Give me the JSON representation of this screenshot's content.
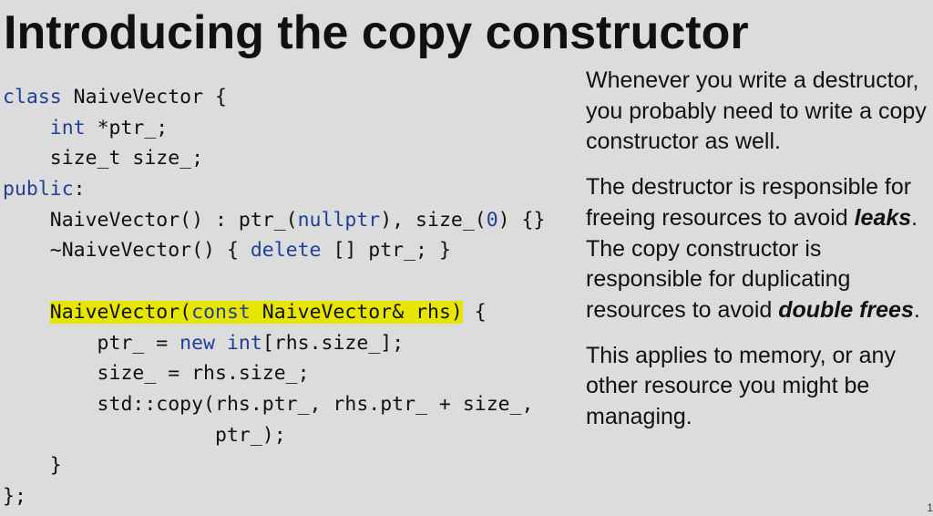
{
  "slide": {
    "title": "Introducing the copy constructor",
    "page_number": "1"
  },
  "code": {
    "l1_kw": "class",
    "l1_rest": " NaiveVector {",
    "l2_ind": "    ",
    "l2_kw": "int",
    "l2_rest": " *ptr_;",
    "l3": "    size_t size_;",
    "l4_kw": "public",
    "l4_rest": ":",
    "l5_a": "    NaiveVector() : ptr_(",
    "l5_kw": "nullptr",
    "l5_b": "), size_(",
    "l5_num": "0",
    "l5_c": ") {}",
    "l6_a": "    ~NaiveVector() { ",
    "l6_kw": "delete",
    "l6_b": " [] ptr_; }",
    "l8_ind": "    ",
    "l8_hl_a": "NaiveVector(",
    "l8_hl_kw": "const",
    "l8_hl_b": " NaiveVector& rhs)",
    "l8_rest": " {",
    "l9_a": "        ptr_ = ",
    "l9_kw1": "new",
    "l9_sp": " ",
    "l9_kw2": "int",
    "l9_b": "[rhs.size_];",
    "l10": "        size_ = rhs.size_;",
    "l11": "        std::copy(rhs.ptr_, rhs.ptr_ + size_,",
    "l12": "                  ptr_);",
    "l13": "    }",
    "l14": "};"
  },
  "prose": {
    "p1": "Whenever you write a destructor, you probably need to write a copy constructor as well.",
    "p2_a": "The destructor is responsible for freeing resources to avoid ",
    "p2_em1": "leaks",
    "p2_b": ". The copy constructor is responsible for duplicating resources to avoid ",
    "p2_em2": "double frees",
    "p2_c": ".",
    "p3": "This applies to memory, or any other resource you might be managing."
  },
  "colors": {
    "background": "#dcdcdc",
    "keyword": "#1f3f99",
    "highlight": "#e6e600"
  }
}
